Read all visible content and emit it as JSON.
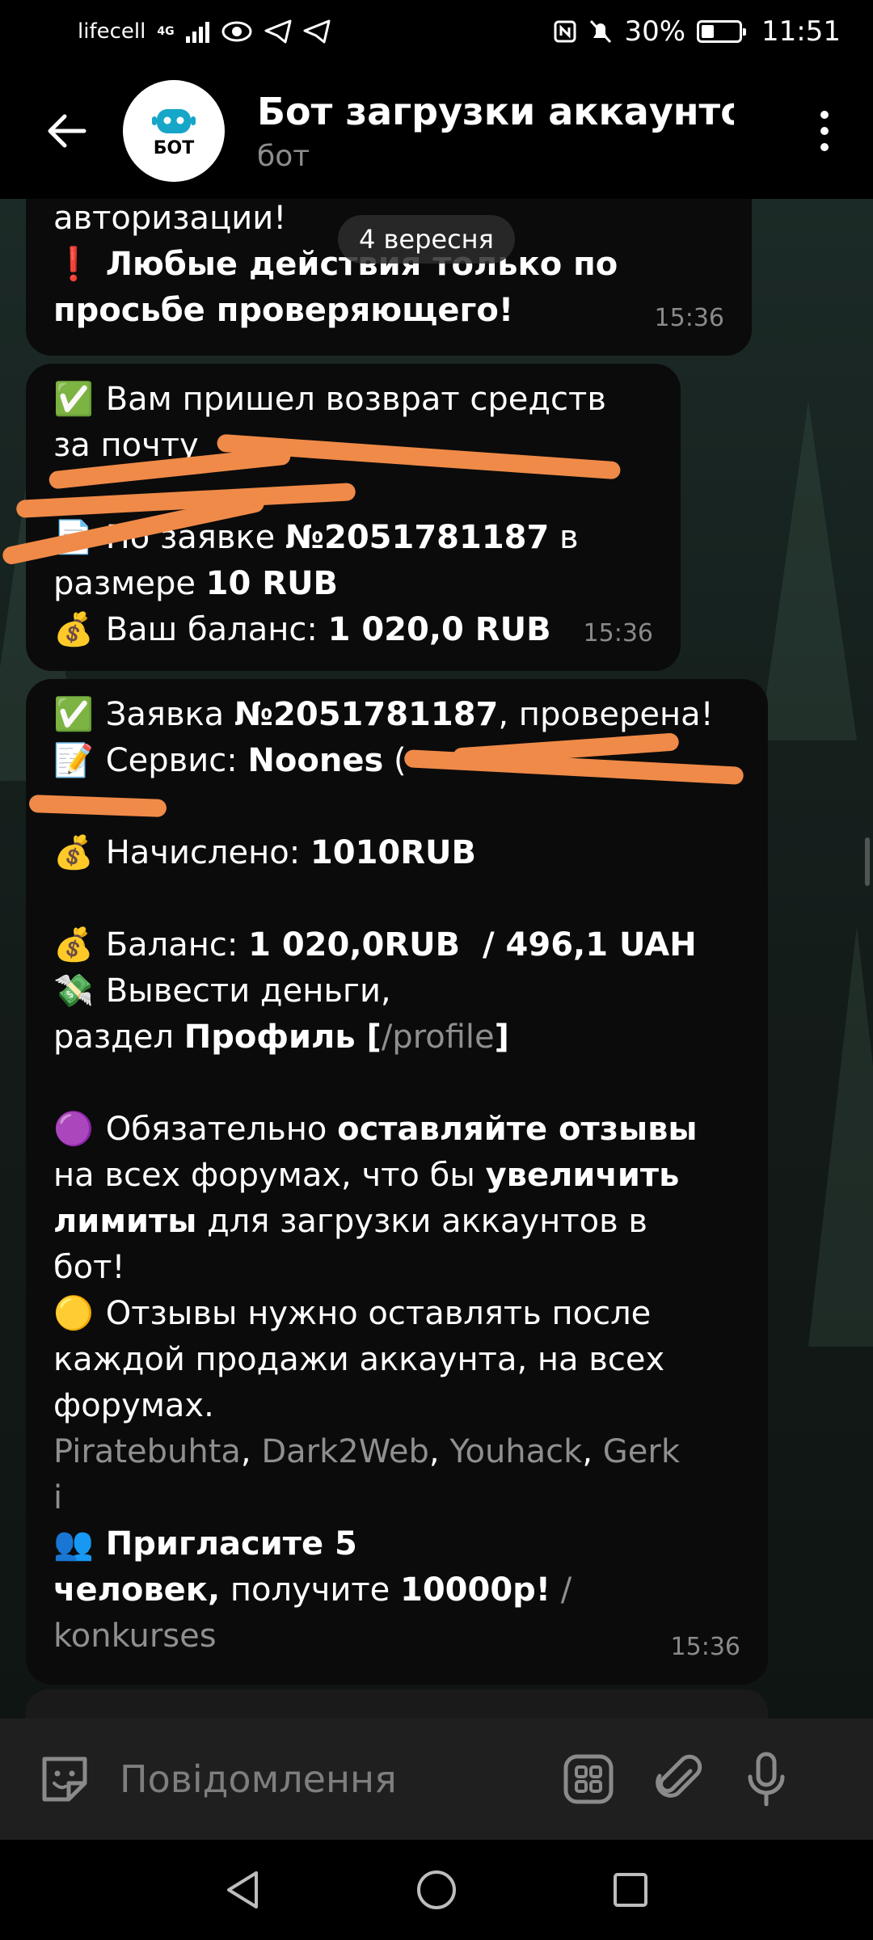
{
  "status_bar": {
    "carrier": "lifecell",
    "network": "4G",
    "battery": "30%",
    "time": "11:51"
  },
  "header": {
    "title": "Бот загрузки аккаунтов",
    "subtitle": "бот",
    "avatar_text": "БОТ"
  },
  "chat": {
    "date_label": "4 вересня",
    "message1": {
      "line1": "авторизации!",
      "warning_emoji": "❗",
      "line2_bold": "Любые действия только по просьбе проверяющего!",
      "time": "15:36"
    },
    "message2": {
      "check_emoji": "✅",
      "line1": "Вам пришел возврат средств за почту",
      "line2_prefix": "По заявке ",
      "order_no": "№2051781187",
      "line2_mid": " в размере ",
      "amount": "10 RUB",
      "doc_emoji": "📄",
      "money_emoji": "💰",
      "balance_label": "Ваш баланс: ",
      "balance_value": "1 020,0 RUB",
      "time": "15:36"
    },
    "message3": {
      "check_emoji": "✅",
      "order_prefix": "Заявка ",
      "order_no": "№2051781187",
      "order_suffix": ", проверена!",
      "memo_emoji": "📝",
      "service_label": "Сервис: ",
      "service_value": "Noones",
      "service_paren": "(",
      "money_emoji": "💰",
      "credited_label": "Начислено: ",
      "credited_value": "1010RUB",
      "balance_label": "Баланс: ",
      "balance_value": "1 020,0RUB  / 496,1 UAH",
      "withdraw_emoji": "💸",
      "withdraw_text": "Вывести деньги,",
      "section_prefix": "раздел ",
      "profile_bold": "Профиль [",
      "profile_cmd": "/profile",
      "profile_close": "]",
      "purple_emoji": "🟣",
      "review_text1": "Обязательно ",
      "review_bold1": "оставляйте отзывы",
      "review_text2": "на всех форумах, что бы ",
      "review_bold2": "увеличить",
      "review_bold3": "лимиты",
      "review_text3": " для загрузки аккаунтов в",
      "review_text4": "бот!",
      "yellow_emoji": "🟡",
      "after_text1": "Отзывы нужно оставлять после",
      "after_text2": "каждой продажи аккаунта, на всех",
      "after_text3": "форумах.",
      "forums": [
        "Piratebuhta",
        "Dark2Web",
        "Youhack",
        "Gerk"
      ],
      "forums_tail": "i",
      "people_emoji": "👥",
      "invite_bold": "Пригласите 5",
      "invite_bold2": "человек,",
      "invite_text": " получите ",
      "invite_reward": "10000р!",
      "invite_sep": " /",
      "konkurses": "konkurses",
      "time": "15:36"
    }
  },
  "input_bar": {
    "placeholder": "Повідомлення"
  },
  "colors": {
    "bubble": "#0b0b0b",
    "scribble": "#f08a48",
    "link": "#8f8f8f",
    "input_bar": "#1f1f1f"
  }
}
